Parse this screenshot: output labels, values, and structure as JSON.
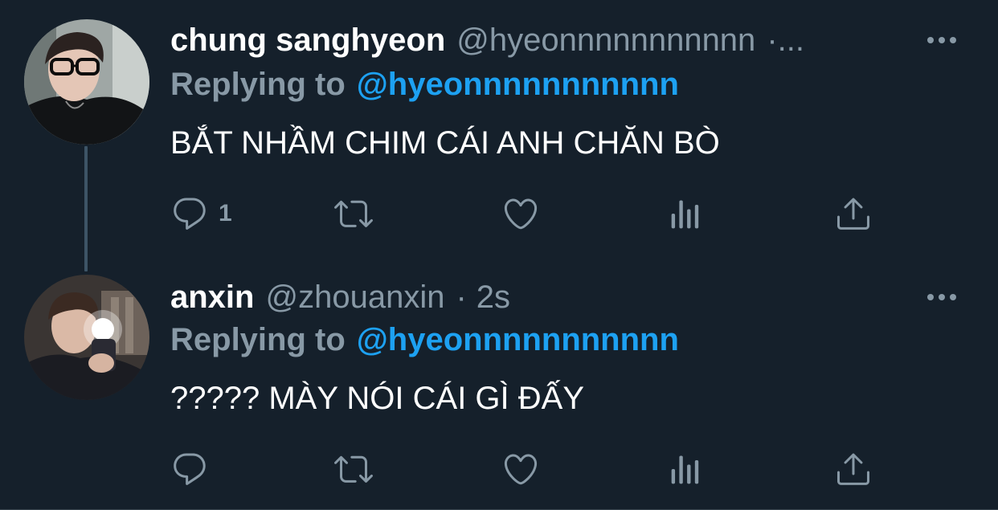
{
  "thread": [
    {
      "display_name": "chung sanghyeon",
      "handle": "@hyeonnnnnnnnnnn",
      "timestamp_sep": "·...",
      "replying_label": "Replying to",
      "replying_to": "@hyeonnnnnnnnnnn",
      "text": "BẮT NHẦM CHIM CÁI ANH CHĂN BÒ",
      "reply_count": "1",
      "avatar": "user-photo-glasses"
    },
    {
      "display_name": "anxin",
      "handle": "@zhouanxin",
      "dot": "·",
      "timestamp": "2s",
      "replying_label": "Replying to",
      "replying_to": "@hyeonnnnnnnnnnn",
      "text": "????? MÀY NÓI CÁI GÌ ĐẤY",
      "reply_count": "",
      "avatar": "user-photo-mirror-selfie"
    }
  ],
  "icons": {
    "reply": "reply-icon",
    "retweet": "retweet-icon",
    "like": "heart-icon",
    "stats": "analytics-icon",
    "share": "share-icon",
    "more": "more-icon"
  },
  "colors": {
    "background": "#15202b",
    "primary_text": "#ffffff",
    "secondary_text": "#8899a6",
    "accent": "#1da1f2",
    "thread_line": "#3d5466"
  }
}
